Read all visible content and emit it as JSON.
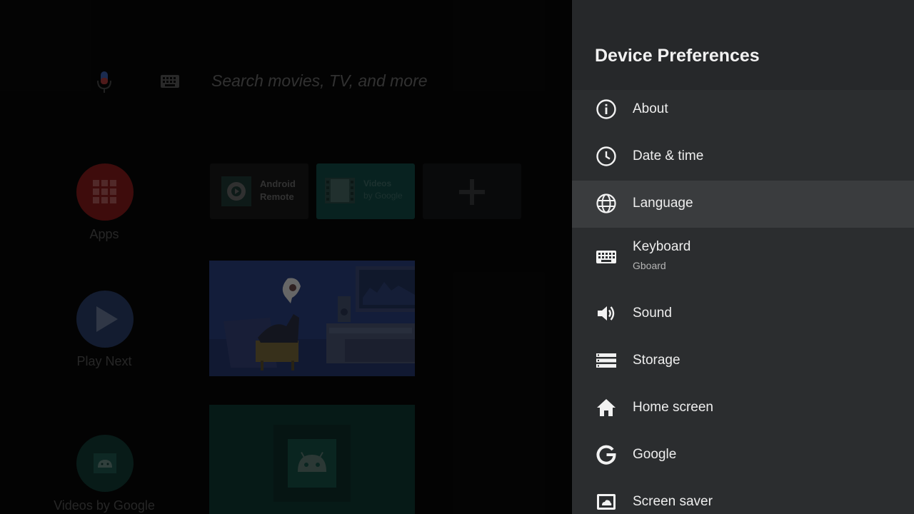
{
  "home": {
    "search_placeholder": "Search movies, TV, and more",
    "sidebar": [
      {
        "label": "Apps",
        "icon": "apps-grid-icon"
      },
      {
        "label": "Play Next",
        "icon": "play-icon"
      },
      {
        "label": "Videos by Google",
        "icon": "android-icon"
      }
    ],
    "favorites": [
      {
        "line1": "Android",
        "line2": "Remote",
        "icon": "android-remote-icon"
      },
      {
        "line1": "Videos",
        "line2": "by Google",
        "icon": "videos-film-icon"
      },
      {
        "line1": "",
        "line2": "",
        "icon": "add-icon"
      }
    ]
  },
  "panel": {
    "title": "Device Preferences",
    "items": [
      {
        "label": "About",
        "sublabel": "",
        "icon": "info-icon"
      },
      {
        "label": "Date & time",
        "sublabel": "",
        "icon": "clock-icon"
      },
      {
        "label": "Language",
        "sublabel": "",
        "icon": "globe-icon",
        "focused": true
      },
      {
        "label": "Keyboard",
        "sublabel": "Gboard",
        "icon": "keyboard-icon"
      },
      {
        "label": "Sound",
        "sublabel": "",
        "icon": "volume-icon"
      },
      {
        "label": "Storage",
        "sublabel": "",
        "icon": "storage-icon"
      },
      {
        "label": "Home screen",
        "sublabel": "",
        "icon": "home-icon"
      },
      {
        "label": "Google",
        "sublabel": "",
        "icon": "google-icon"
      },
      {
        "label": "Screen saver",
        "sublabel": "",
        "icon": "screen-saver-icon"
      }
    ]
  },
  "colors": {
    "panel_bg": "#2b2d2f",
    "panel_header_bg": "#26282a",
    "focused_row_bg": "#3a3c3e",
    "apps_red": "#c62828",
    "play_blue": "#3b5998",
    "videos_teal": "#1f6b60"
  }
}
